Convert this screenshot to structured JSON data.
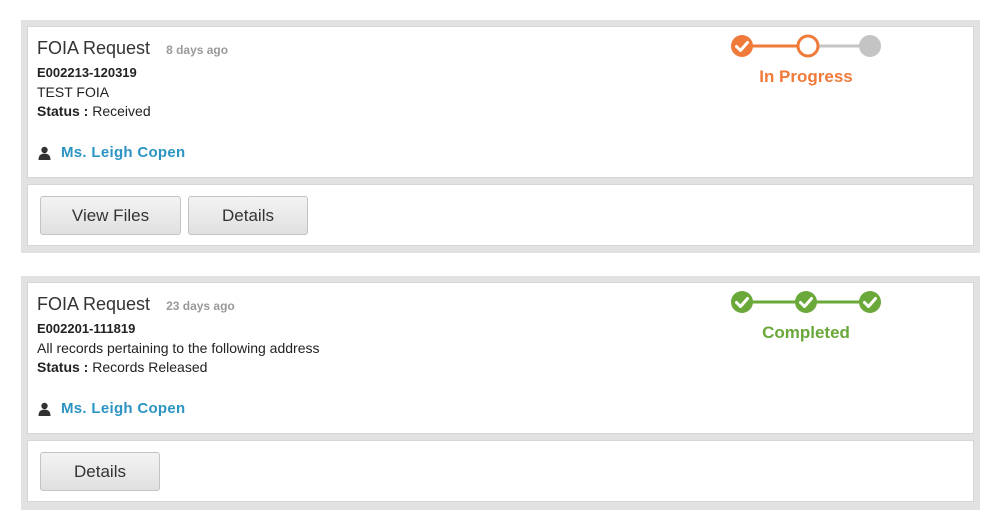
{
  "requests": [
    {
      "title": "FOIA Request",
      "ago": "8 days ago",
      "id": "E002213-120319",
      "description": "TEST FOIA",
      "status_label": "Status :",
      "status_value": "Received",
      "person": "Ms. Leigh Copen",
      "progress": {
        "label": "In Progress",
        "color": "#ef7a3a",
        "steps_completed": 1,
        "steps_total": 3
      },
      "buttons": [
        "View Files",
        "Details"
      ]
    },
    {
      "title": "FOIA Request",
      "ago": "23 days ago",
      "id": "E002201-111819",
      "description": "All records pertaining to the following address",
      "status_label": "Status :",
      "status_value": "Records Released",
      "person": "Ms. Leigh Copen",
      "progress": {
        "label": "Completed",
        "color": "#6aa83a",
        "steps_completed": 3,
        "steps_total": 3
      },
      "buttons": [
        "Details"
      ]
    }
  ],
  "icons": {
    "person": "user-icon",
    "check": "check-icon"
  },
  "colors": {
    "link": "#2b94c3",
    "pending": "#c4c4c4",
    "card_bg": "#e2e2e2"
  }
}
